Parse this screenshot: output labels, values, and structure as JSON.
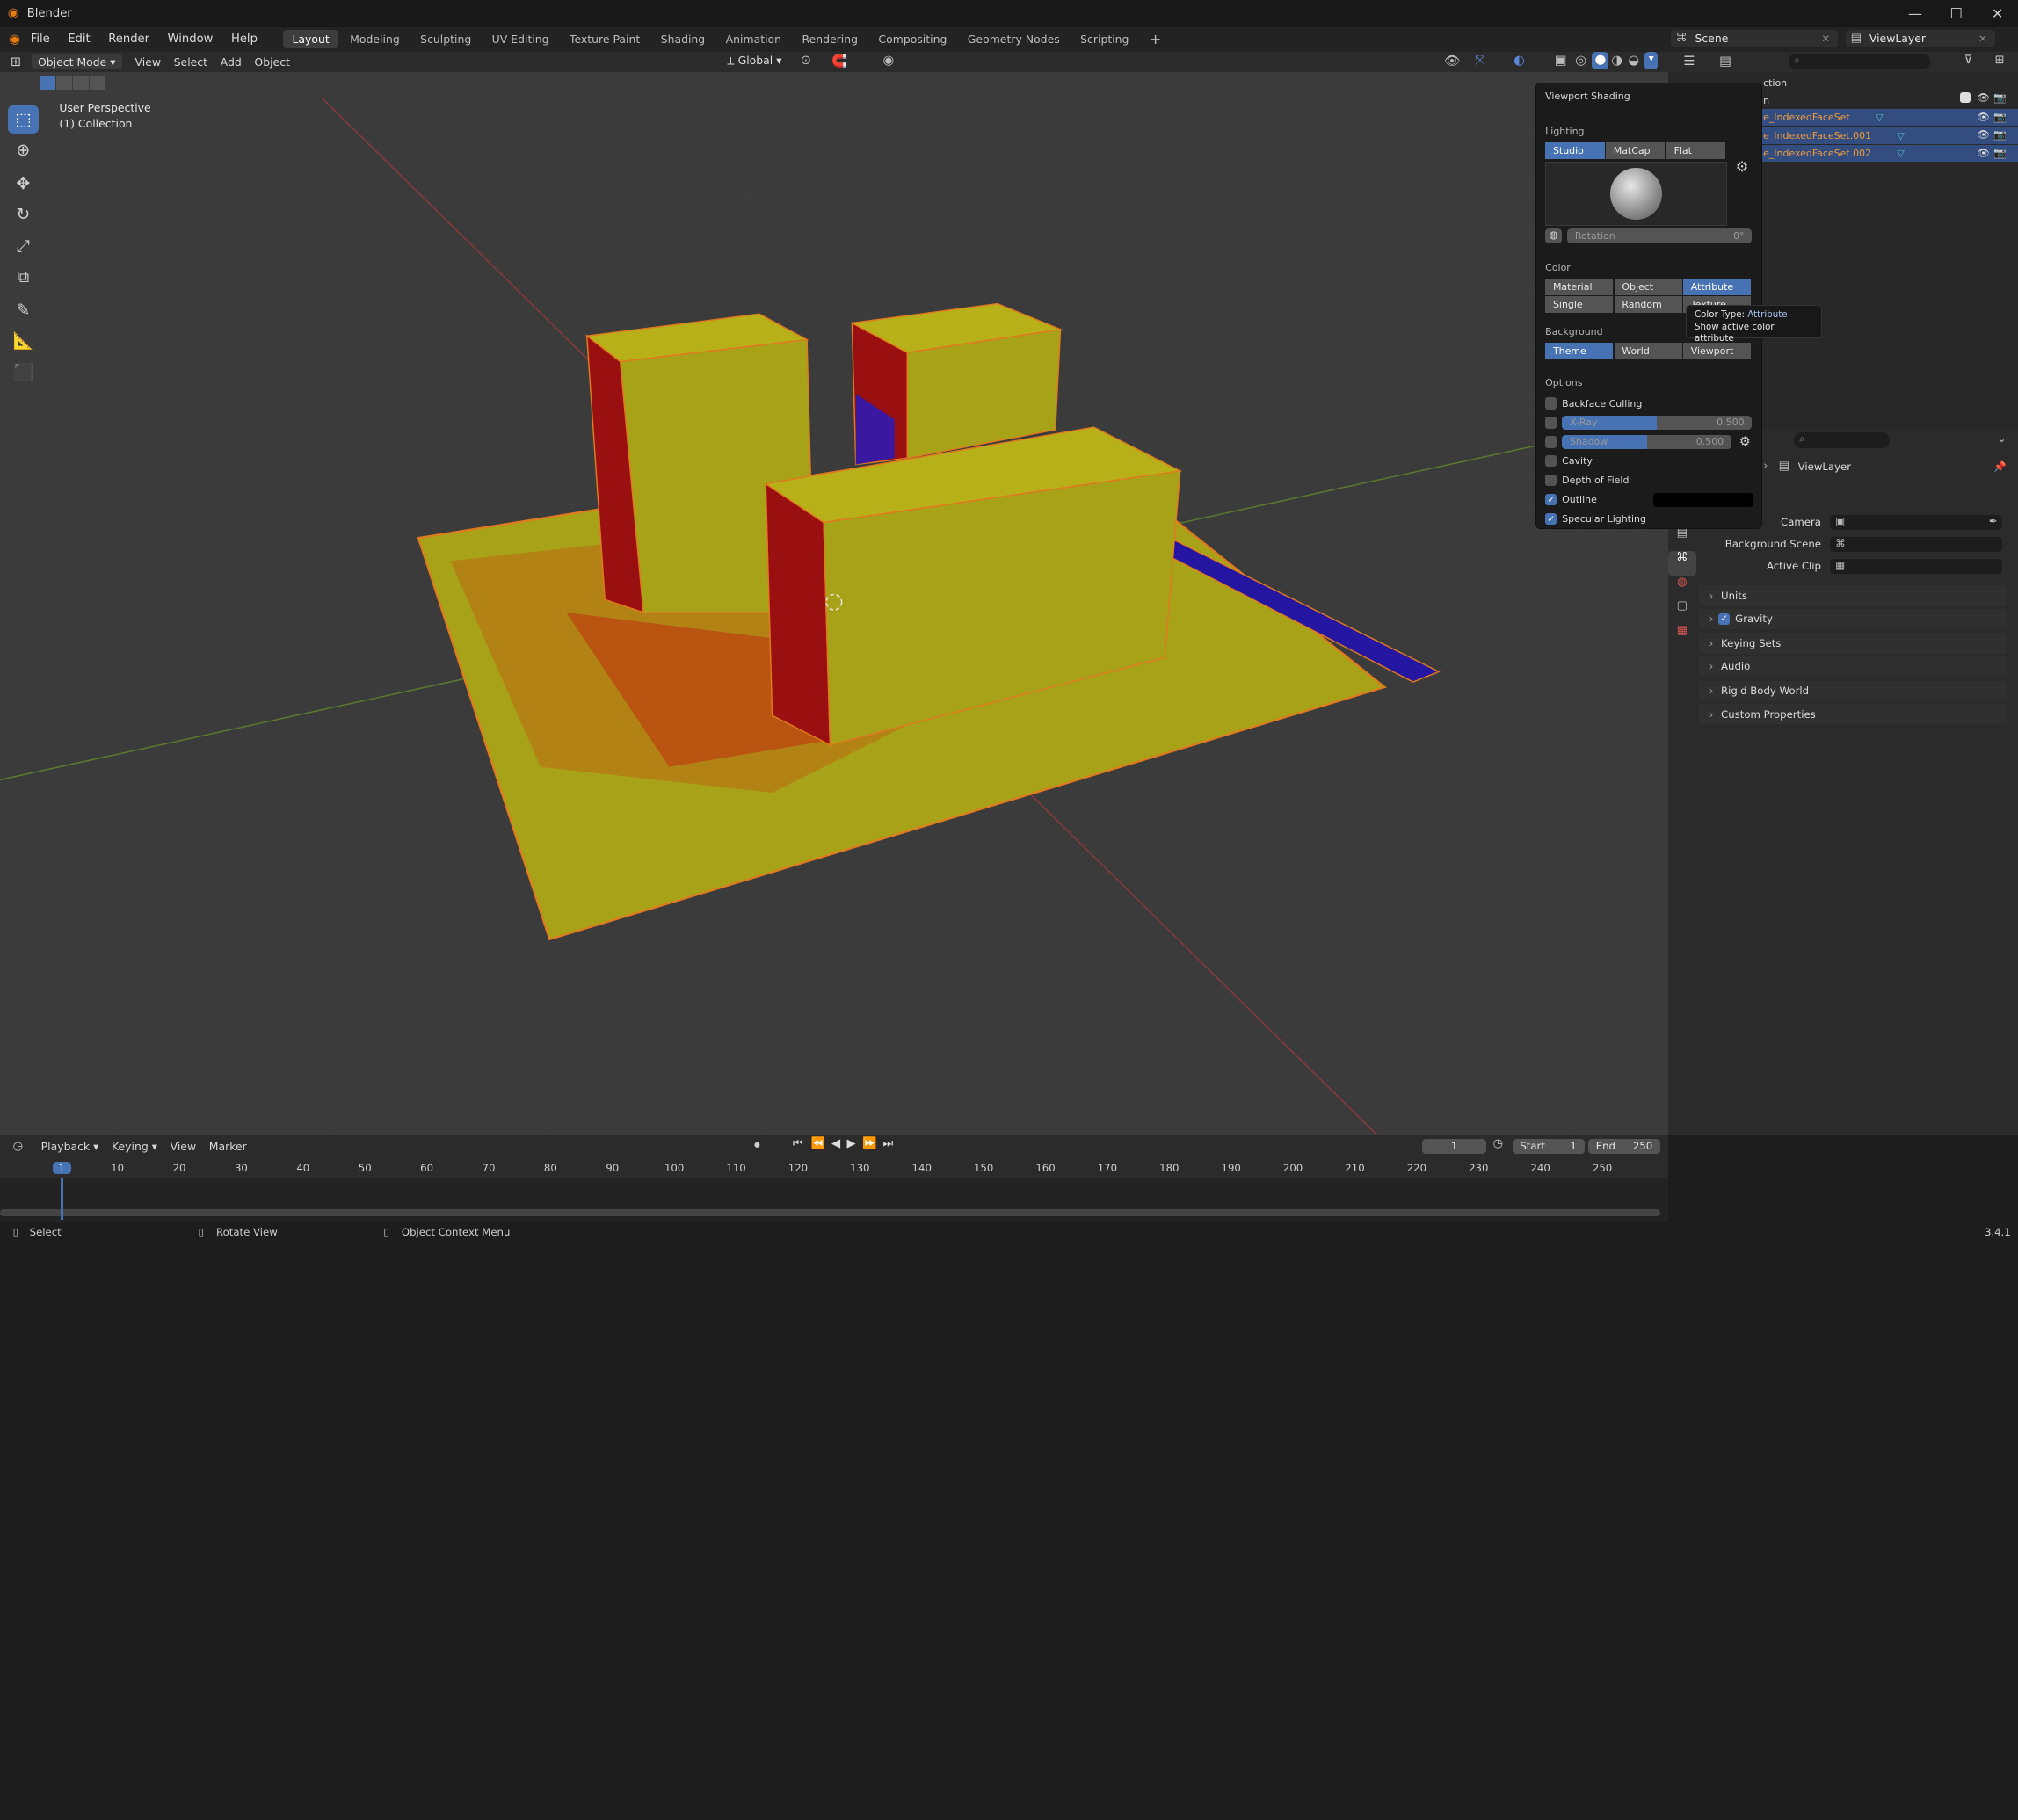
{
  "window": {
    "title": "Blender"
  },
  "menu": [
    "File",
    "Edit",
    "Render",
    "Window",
    "Help"
  ],
  "workspaces": [
    "Layout",
    "Modeling",
    "Sculpting",
    "UV Editing",
    "Texture Paint",
    "Shading",
    "Animation",
    "Rendering",
    "Compositing",
    "Geometry Nodes",
    "Scripting"
  ],
  "active_workspace": "Layout",
  "scene": {
    "name": "Scene",
    "view_layer": "ViewLayer"
  },
  "viewport_header": {
    "mode": "Object Mode",
    "menus": [
      "View",
      "Select",
      "Add",
      "Object"
    ],
    "transform": "Global"
  },
  "viewport": {
    "perspective": "User Perspective",
    "collection": "(1) Collection"
  },
  "shading": {
    "title": "Viewport Shading",
    "lighting_label": "Lighting",
    "lighting": [
      "Studio",
      "MatCap",
      "Flat"
    ],
    "lighting_active": "Studio",
    "rotation_label": "Rotation",
    "rotation_value": "0°",
    "color_label": "Color",
    "color_row1": [
      "Material",
      "Object",
      "Attribute"
    ],
    "color_row2": [
      "Single",
      "Random",
      "Texture"
    ],
    "color_active": "Attribute",
    "background_label": "Background",
    "background": [
      "Theme",
      "World",
      "Viewport"
    ],
    "background_active": "Theme",
    "options_label": "Options",
    "options": {
      "backface": "Backface Culling",
      "xray": "X-Ray",
      "xray_value": "0.500",
      "xray_fraction": 0.5,
      "shadow": "Shadow",
      "shadow_value": "0.500",
      "shadow_fraction": 0.5,
      "cavity": "Cavity",
      "dof": "Depth of Field",
      "outline": "Outline",
      "specular": "Specular Lighting"
    }
  },
  "tooltip": {
    "label": "Color Type:",
    "value": "Attribute",
    "desc": "Show active color attribute"
  },
  "outliner": {
    "header_partial": "ction",
    "row0_partial": "n",
    "items": [
      "e_IndexedFaceSet",
      "e_IndexedFaceSet.001",
      "e_IndexedFaceSet.002"
    ]
  },
  "properties": {
    "view_layer": "ViewLayer",
    "camera_label": "Camera",
    "bg_scene_label": "Background Scene",
    "active_clip_label": "Active Clip",
    "panels": [
      "Units",
      "Gravity",
      "Keying Sets",
      "Audio",
      "Rigid Body World",
      "Custom Properties"
    ]
  },
  "timeline": {
    "menus": [
      "Playback",
      "Keying",
      "View",
      "Marker"
    ],
    "current_frame": "1",
    "start_label": "Start",
    "start": "1",
    "end_label": "End",
    "end": "250",
    "ticks": [
      "1",
      "10",
      "20",
      "30",
      "40",
      "50",
      "60",
      "70",
      "80",
      "90",
      "100",
      "110",
      "120",
      "130",
      "140",
      "150",
      "160",
      "170",
      "180",
      "190",
      "200",
      "210",
      "220",
      "230",
      "240",
      "250"
    ]
  },
  "status": {
    "select": "Select",
    "rotate": "Rotate View",
    "context": "Object Context Menu",
    "version": "3.4.1"
  }
}
